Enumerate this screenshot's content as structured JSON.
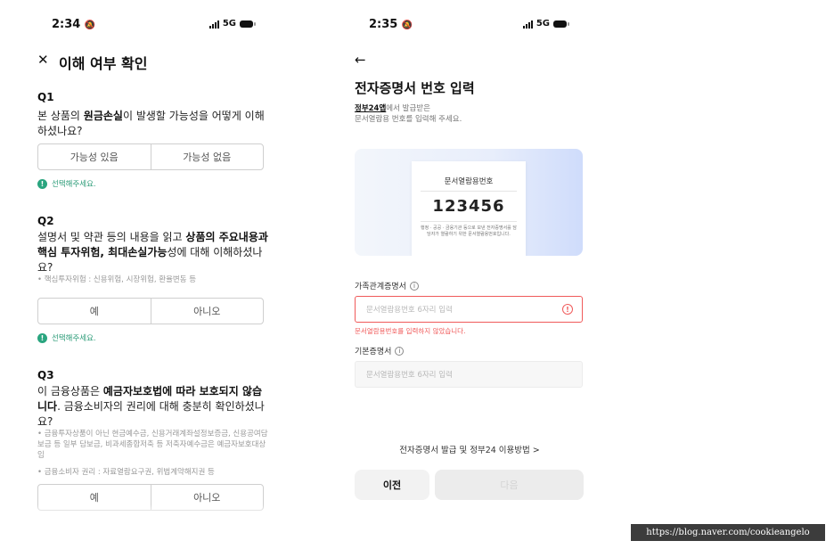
{
  "left_screen": {
    "status_time": "2:34",
    "network": "5G",
    "close_icon": "✕",
    "title": "이해 여부 확인",
    "hint_text": "선택해주세요.",
    "q1": {
      "label": "Q1",
      "text_pre": "본 상품의 ",
      "text_bold": "원금손실",
      "text_post": "이 발생할 가능성을 어떻게 이해하셨나요?",
      "options": [
        "가능성 있음",
        "가능성 없음"
      ]
    },
    "q2": {
      "label": "Q2",
      "text_pre": "설명서 및 약관 등의 내용을 읽고 ",
      "text_bold": "상품의 주요내용과 핵심 투자위험, 최대손실가능",
      "text_post": "성에 대해 이해하셨나요?",
      "note": "• 핵심투자위험 : 신용위험, 시장위험, 환율변동 등",
      "options": [
        "예",
        "아니오"
      ]
    },
    "q3": {
      "label": "Q3",
      "text_pre": "이 금융상품은 ",
      "text_bold": "예금자보호법에 따라 보호되지 않습니다",
      "text_post": ". 금융소비자의 권리에 대해 충분히 확인하셨나요?",
      "note1": "• 금융투자상품이 아닌 현금예수금, 신용거래계좌설정보증금, 신용공여담보금 등 일부 담보금, 비과세종합저축 등 저축자예수금은 예금자보호대상임",
      "note2": "• 금융소비자 권리 : 자료열람요구권, 위법계약해지권 등",
      "options": [
        "예",
        "아니오"
      ]
    }
  },
  "right_screen": {
    "status_time": "2:35",
    "network": "5G",
    "back_icon": "←",
    "title": "전자증명서 번호 입력",
    "subtitle_link": "정부24앱",
    "subtitle_rest": "에서 발급받은",
    "subtitle_line2": "문서열람용 번호를 입력해 주세요.",
    "ticket": {
      "title": "문서열람용번호",
      "number": "123456",
      "desc": "행정 · 공공 · 금융기관 등으로 보낸 전자증명서를 담당자가 열람하기 위한 문서열람용번호입니다."
    },
    "field1": {
      "label": "가족관계증명서",
      "placeholder": "문서열람용번호 6자리 입력",
      "error": "문서열람용번호를 입력하지 않았습니다."
    },
    "field2": {
      "label": "기본증명서",
      "placeholder": "문서열람용번호 6자리 입력"
    },
    "help_link": "전자증명서 발급 및 정부24 이용방법 >",
    "prev_button": "이전",
    "next_button": "다음"
  },
  "watermark": "https://blog.naver.com/cookieangelo",
  "colors": {
    "accent_green": "#2aa57f",
    "error_red": "#f05a5a",
    "ticket_gradient_end": "#cfdcfb"
  },
  "icons": [
    "close-icon",
    "back-arrow-icon",
    "info-icon",
    "error-icon",
    "check-hint-icon",
    "battery-icon",
    "signal-icon",
    "bell-icon"
  ]
}
